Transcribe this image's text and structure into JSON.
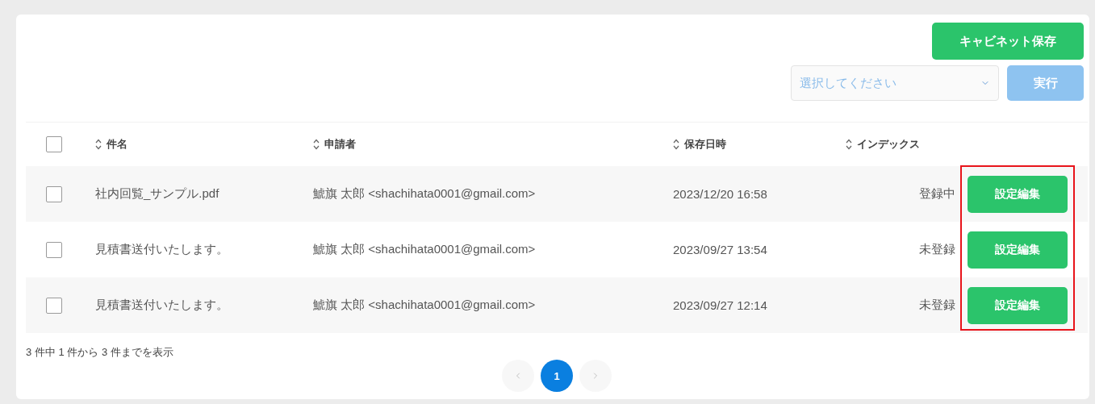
{
  "toolbar": {
    "save_button": "キャビネット保存",
    "select": {
      "placeholder": "選択してください"
    },
    "run_button": {
      "label": "実行",
      "disabled": true
    }
  },
  "table": {
    "select_all": {
      "checked": false
    },
    "columns": [
      "件名",
      "申請者",
      "保存日時",
      "インデックス"
    ],
    "rows": [
      {
        "checked": false,
        "title": "社内回覧_サンプル.pdf",
        "applicant": "鯱旗 太郎 <shachihata0001@gmail.com>",
        "saved_at": "2023/12/20 16:58",
        "index": "登録中",
        "action": "設定編集"
      },
      {
        "checked": false,
        "title": "見積書送付いたします。",
        "applicant": "鯱旗 太郎 <shachihata0001@gmail.com>",
        "saved_at": "2023/09/27 13:54",
        "index": "未登録",
        "action": "設定編集"
      },
      {
        "checked": false,
        "title": "見積書送付いたします。",
        "applicant": "鯱旗 太郎 <shachihata0001@gmail.com>",
        "saved_at": "2023/09/27 12:14",
        "index": "未登録",
        "action": "設定編集"
      }
    ]
  },
  "summary": "3 件中 1 件から 3 件までを表示",
  "pagination": {
    "prev_disabled": true,
    "next_disabled": true,
    "pages": [
      {
        "label": "1",
        "selected": true
      }
    ]
  }
}
